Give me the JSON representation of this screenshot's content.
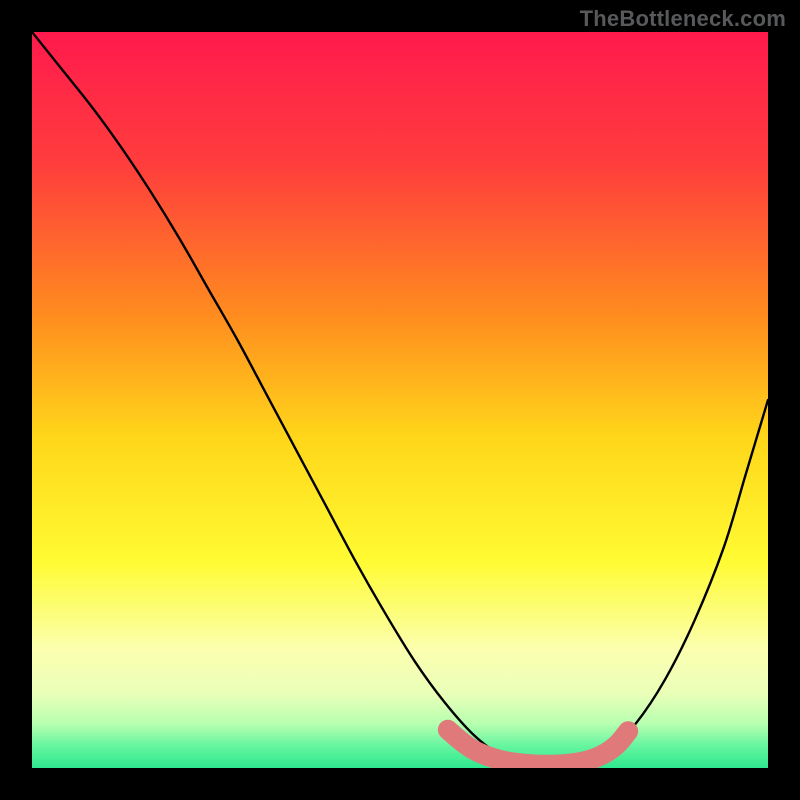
{
  "watermark": "TheBottleneck.com",
  "chart_data": {
    "type": "line",
    "title": "",
    "xlabel": "",
    "ylabel": "",
    "xlim": [
      0,
      100
    ],
    "ylim": [
      0,
      100
    ],
    "grid": false,
    "legend": false,
    "background_gradient": {
      "stops": [
        {
          "offset": 0.0,
          "color": "#ff1a4d"
        },
        {
          "offset": 0.18,
          "color": "#ff3d3d"
        },
        {
          "offset": 0.38,
          "color": "#ff8a1f"
        },
        {
          "offset": 0.55,
          "color": "#ffd61a"
        },
        {
          "offset": 0.72,
          "color": "#fffb33"
        },
        {
          "offset": 0.84,
          "color": "#fbffb0"
        },
        {
          "offset": 0.9,
          "color": "#e9ffb8"
        },
        {
          "offset": 0.94,
          "color": "#b6ffb0"
        },
        {
          "offset": 0.97,
          "color": "#66f5a0"
        },
        {
          "offset": 1.0,
          "color": "#2ee88f"
        }
      ]
    },
    "series": [
      {
        "name": "bottleneck-curve",
        "color": "#000000",
        "width": 2.4,
        "x": [
          0,
          4,
          8,
          12,
          16,
          20,
          24,
          28,
          32,
          36,
          40,
          44,
          48,
          52,
          56,
          60,
          63.5,
          66,
          69,
          72,
          75,
          78,
          82,
          86,
          90,
          94,
          97,
          100
        ],
        "y": [
          100,
          95,
          90,
          84.5,
          78.5,
          72,
          65,
          58,
          50.5,
          43,
          35.5,
          28,
          21,
          14.5,
          9,
          4.5,
          1.8,
          0.6,
          0.2,
          0.2,
          0.6,
          2.0,
          6,
          12,
          20,
          30,
          40,
          50
        ]
      }
    ],
    "overlay": {
      "name": "sweet-spot",
      "color": "#e07a7a",
      "x": [
        56.5,
        58.5,
        60.5,
        64,
        68,
        72,
        75,
        77.5,
        79.5,
        81
      ],
      "y": [
        5.2,
        3.5,
        2.2,
        1.0,
        0.5,
        0.5,
        0.9,
        1.8,
        3.2,
        5.0
      ],
      "dot_radii": [
        9,
        9,
        9,
        10,
        10,
        10,
        10,
        10,
        10,
        10
      ]
    }
  }
}
